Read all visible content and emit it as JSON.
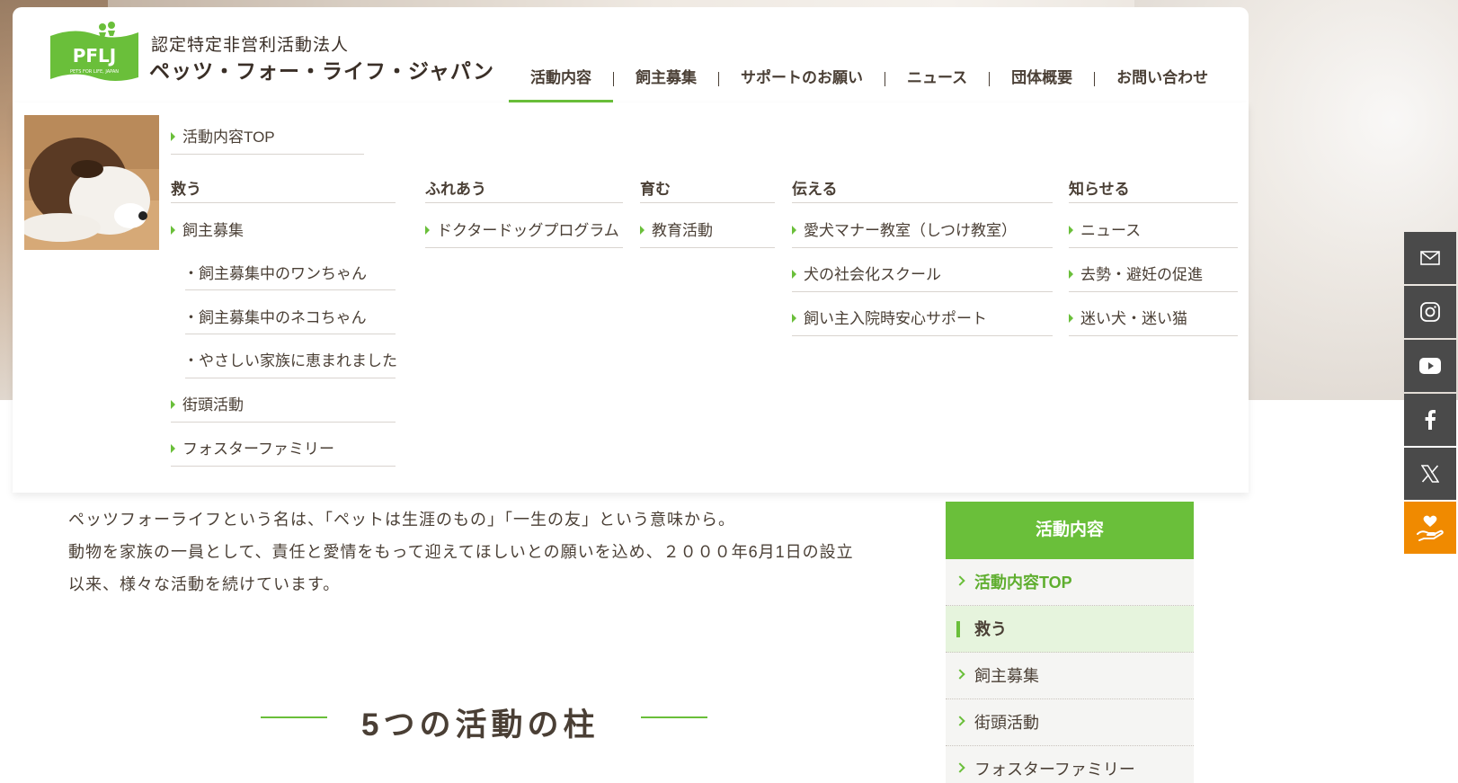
{
  "header": {
    "org_type": "認定特定非営利活動法人",
    "org_name": "ペッツ・フォー・ライフ・ジャパン",
    "logo_text": "PFLJ",
    "logo_sub": "PETS FOR LIFE, JAPAN"
  },
  "nav": {
    "items": [
      "活動内容",
      "飼主募集",
      "サポートのお願い",
      "ニュース",
      "団体概要",
      "お問い合わせ"
    ],
    "active": "活動内容"
  },
  "mega": {
    "top_link": "活動内容TOP",
    "columns": [
      {
        "heading": "救う",
        "links": [
          "飼主募集"
        ],
        "sub_links": [
          "・飼主募集中のワンちゃん",
          "・飼主募集中のネコちゃん",
          "・やさしい家族に恵まれました"
        ],
        "more_links": [
          "街頭活動",
          "フォスターファミリー"
        ]
      },
      {
        "heading": "ふれあう",
        "links": [
          "ドクタードッグプログラム"
        ]
      },
      {
        "heading": "育む",
        "links": [
          "教育活動"
        ]
      },
      {
        "heading": "伝える",
        "links": [
          "愛犬マナー教室（しつけ教室）",
          "犬の社会化スクール",
          "飼い主入院時安心サポート"
        ]
      },
      {
        "heading": "知らせる",
        "links": [
          "ニュース",
          "去勢・避妊の促進",
          "迷い犬・迷い猫"
        ]
      }
    ]
  },
  "intro": {
    "line1": "ペッツフォーライフという名は、「ペットは生涯のもの」「一生の友」という意味から。",
    "line2": "動物を家族の一員として、責任と愛情をもって迎えてほしいとの願いを込め、２０００年6月1日の設立",
    "line3": "以来、様々な活動を続けています。"
  },
  "section_title": "5つの活動の柱",
  "side_nav": {
    "heading": "活動内容",
    "items": [
      "活動内容TOP",
      "救う",
      "飼主募集",
      "街頭活動",
      "フォスターファミリー"
    ]
  },
  "social": [
    "mail-icon",
    "instagram-icon",
    "youtube-icon",
    "facebook-icon",
    "x-icon",
    "donate-icon"
  ],
  "colors": {
    "accent": "#6abf3a",
    "text": "#4a3f35",
    "donate": "#f08a00",
    "rail": "#4a4a4a"
  }
}
